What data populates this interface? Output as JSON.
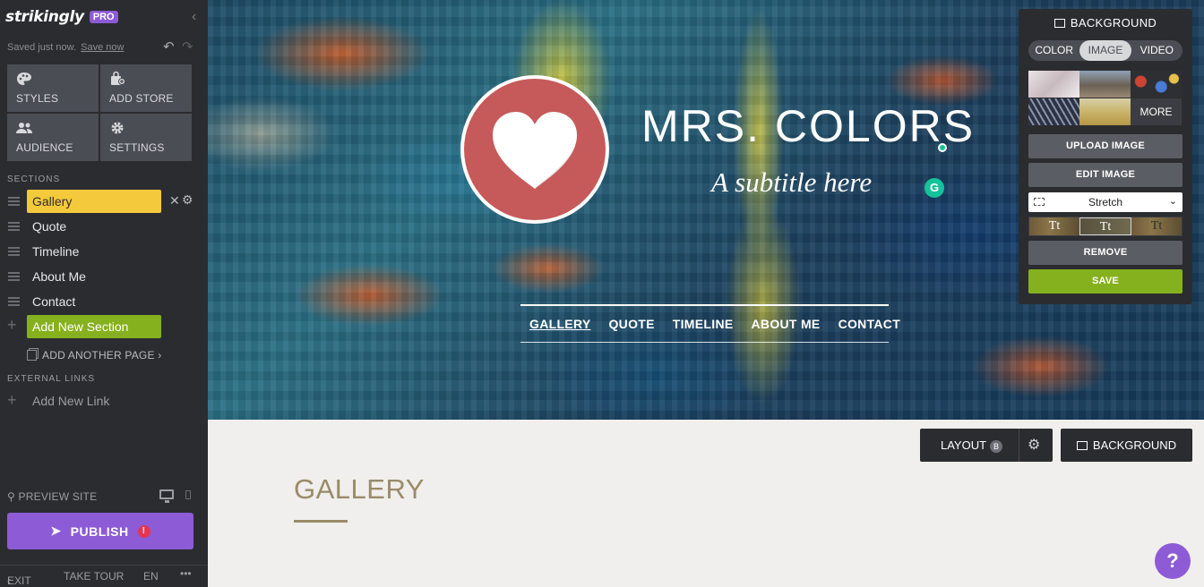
{
  "sidebar": {
    "logo": "strikingly",
    "badge": "PRO",
    "saved_text": "Saved just now.",
    "save_now": "Save now",
    "tiles": [
      {
        "label": "STYLES",
        "icon": "palette-icon"
      },
      {
        "label": "ADD STORE",
        "icon": "store-icon"
      },
      {
        "label": "AUDIENCE",
        "icon": "people-icon"
      },
      {
        "label": "SETTINGS",
        "icon": "gear-icon"
      }
    ],
    "sections_heading": "SECTIONS",
    "sections": [
      "Gallery",
      "Quote",
      "Timeline",
      "About Me",
      "Contact"
    ],
    "add_section": "Add New Section",
    "add_page": "ADD ANOTHER PAGE ›",
    "external_heading": "EXTERNAL LINKS",
    "add_link": "Add New Link",
    "preview": "PREVIEW SITE",
    "publish": "PUBLISH",
    "publish_alert": "!",
    "bottom": {
      "exit": "EXIT",
      "tour": "TAKE TOUR",
      "lang": "EN",
      "more": "•••"
    }
  },
  "hero": {
    "title": "MRS. COLORS",
    "subtitle": "A subtitle here",
    "nav": [
      "GALLERY",
      "QUOTE",
      "TIMELINE",
      "ABOUT ME",
      "CONTACT"
    ],
    "grammarly": "G"
  },
  "background_panel": {
    "title": "BACKGROUND",
    "tabs": [
      "COLOR",
      "IMAGE",
      "VIDEO"
    ],
    "active_tab": "IMAGE",
    "more": "MORE",
    "upload": "UPLOAD IMAGE",
    "edit": "EDIT IMAGE",
    "fit": "Stretch",
    "text_styles": [
      "Tt",
      "Tt",
      "Tt"
    ],
    "remove": "REMOVE",
    "save": "SAVE"
  },
  "section": {
    "layout_label": "LAYOUT",
    "layout_badge": "B",
    "background_label": "BACKGROUND",
    "title": "GALLERY"
  },
  "help": "?",
  "colors": {
    "accent": "#8d5bd6",
    "highlight": "#f4c93c",
    "green": "#86b11e",
    "gallery": "#9a8b69"
  }
}
